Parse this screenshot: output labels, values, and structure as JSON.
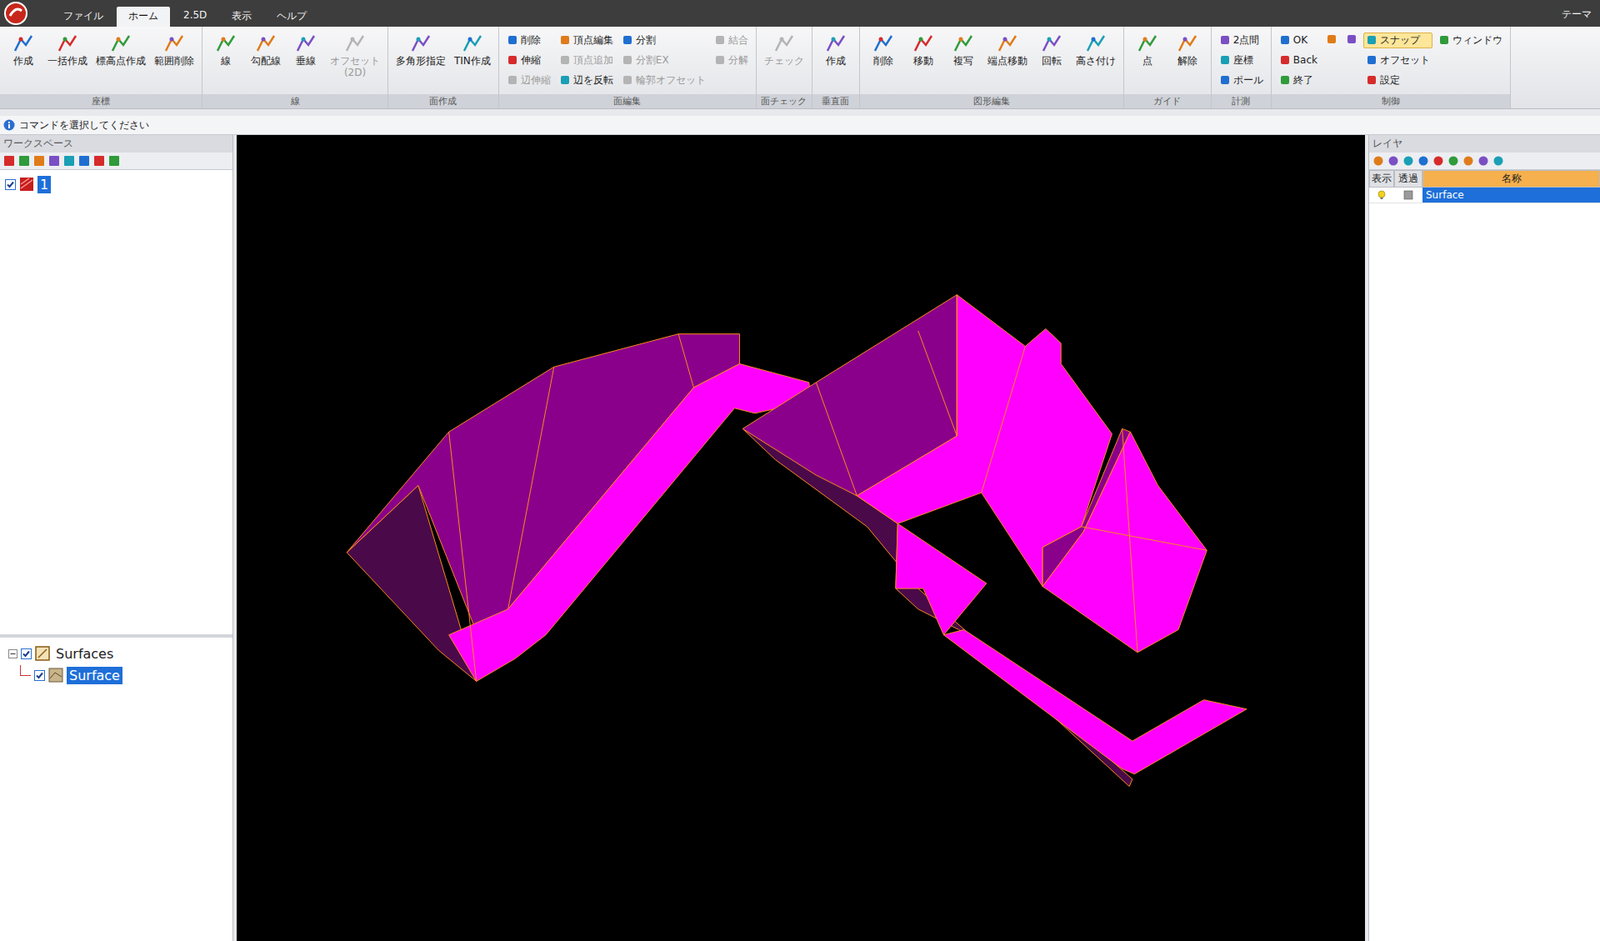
{
  "menu_tabs": [
    {
      "label": "ファイル",
      "selected": false
    },
    {
      "label": "ホーム",
      "selected": true
    },
    {
      "label": "2.5D",
      "selected": false
    },
    {
      "label": "表示",
      "selected": false
    },
    {
      "label": "ヘルプ",
      "selected": false
    }
  ],
  "theme_label": "テーマ",
  "ribbon": [
    {
      "group": "座標",
      "tools": [
        {
          "label": "作成",
          "kind": "large",
          "disabled": false,
          "selected": false
        },
        {
          "label": "一括作成",
          "kind": "large",
          "disabled": false,
          "selected": false
        },
        {
          "label": "標高点作成",
          "kind": "large",
          "disabled": false,
          "selected": false
        },
        {
          "label": "範囲削除",
          "kind": "large",
          "disabled": false,
          "selected": false
        }
      ]
    },
    {
      "group": "線",
      "tools": [
        {
          "label": "線",
          "kind": "large",
          "disabled": false,
          "selected": false
        },
        {
          "label": "勾配線",
          "kind": "large",
          "disabled": false,
          "selected": false
        },
        {
          "label": "垂線",
          "kind": "large",
          "disabled": false,
          "selected": false
        },
        {
          "label": "オフセット(2D)",
          "kind": "large",
          "disabled": true,
          "selected": false
        }
      ]
    },
    {
      "group": "面作成",
      "tools": [
        {
          "label": "多角形指定",
          "kind": "large",
          "disabled": false,
          "selected": false
        },
        {
          "label": "TIN作成",
          "kind": "large",
          "disabled": false,
          "selected": false
        }
      ]
    },
    {
      "group": "面編集",
      "tools": [
        {
          "label": "削除",
          "kind": "small",
          "disabled": false,
          "selected": false
        },
        {
          "label": "伸縮",
          "kind": "small",
          "disabled": false,
          "selected": false
        },
        {
          "label": "辺伸縮",
          "kind": "small",
          "disabled": true,
          "selected": false
        },
        {
          "label": "頂点編集",
          "kind": "small",
          "disabled": false,
          "selected": false
        },
        {
          "label": "頂点追加",
          "kind": "small",
          "disabled": true,
          "selected": false
        },
        {
          "label": "辺を反転",
          "kind": "small",
          "disabled": false,
          "selected": false
        },
        {
          "label": "分割",
          "kind": "small",
          "disabled": false,
          "selected": false
        },
        {
          "label": "分割EX",
          "kind": "small",
          "disabled": true,
          "selected": false
        },
        {
          "label": "輪郭オフセット",
          "kind": "small",
          "disabled": true,
          "selected": false
        },
        {
          "label": "結合",
          "kind": "small",
          "disabled": true,
          "selected": false
        },
        {
          "label": "分解",
          "kind": "small",
          "disabled": true,
          "selected": false
        }
      ]
    },
    {
      "group": "面チェック",
      "tools": [
        {
          "label": "チェック",
          "kind": "large",
          "disabled": true,
          "selected": false
        }
      ]
    },
    {
      "group": "垂直面",
      "tools": [
        {
          "label": "作成",
          "kind": "large",
          "disabled": false,
          "selected": false
        }
      ]
    },
    {
      "group": "図形編集",
      "tools": [
        {
          "label": "削除",
          "kind": "large",
          "disabled": false,
          "selected": false
        },
        {
          "label": "移動",
          "kind": "large",
          "disabled": false,
          "selected": false
        },
        {
          "label": "複写",
          "kind": "large",
          "disabled": false,
          "selected": false
        },
        {
          "label": "端点移動",
          "kind": "large",
          "disabled": false,
          "selected": false
        },
        {
          "label": "回転",
          "kind": "large",
          "disabled": false,
          "selected": false
        },
        {
          "label": "高さ付け",
          "kind": "large",
          "disabled": false,
          "selected": false
        }
      ]
    },
    {
      "group": "ガイド",
      "tools": [
        {
          "label": "点",
          "kind": "large",
          "disabled": false,
          "selected": false
        },
        {
          "label": "解除",
          "kind": "large",
          "disabled": false,
          "selected": false
        }
      ]
    },
    {
      "group": "計測",
      "tools": [
        {
          "label": "2点間",
          "kind": "small",
          "disabled": false,
          "selected": false
        },
        {
          "label": "座標",
          "kind": "small",
          "disabled": false,
          "selected": false
        },
        {
          "label": "ポール",
          "kind": "small",
          "disabled": false,
          "selected": false
        }
      ]
    },
    {
      "group": "制御",
      "tools": [
        {
          "label": "OK",
          "kind": "small",
          "disabled": false,
          "selected": false
        },
        {
          "label": "Back",
          "kind": "small",
          "disabled": false,
          "selected": false
        },
        {
          "label": "終了",
          "kind": "small",
          "disabled": false,
          "selected": false
        },
        {
          "kind": "icon",
          "disabled": false,
          "selected": false
        },
        {
          "kind": "icon",
          "disabled": false,
          "selected": false
        },
        {
          "label": "スナップ",
          "kind": "small",
          "disabled": false,
          "selected": true
        },
        {
          "label": "オフセット",
          "kind": "small",
          "disabled": false,
          "selected": false
        },
        {
          "label": "設定",
          "kind": "small",
          "disabled": false,
          "selected": false
        },
        {
          "label": "ウィンドウ",
          "kind": "small",
          "disabled": false,
          "selected": false
        }
      ]
    }
  ],
  "status": "コマンドを選択してください",
  "workspace": {
    "title": "ワークスペース",
    "items": [
      {
        "label": "1",
        "checked": true,
        "selected": true
      }
    ]
  },
  "tree": [
    {
      "label": "Surfaces",
      "checked": true,
      "expanded": true,
      "selected": false,
      "children": [
        {
          "label": "Surface",
          "checked": true,
          "selected": true
        }
      ]
    }
  ],
  "layers": {
    "title": "レイヤ",
    "columns": [
      "表示",
      "透過",
      "名称"
    ],
    "rows": [
      {
        "name": "Surface",
        "visible": true,
        "transparent": false,
        "selected": true
      }
    ]
  }
}
